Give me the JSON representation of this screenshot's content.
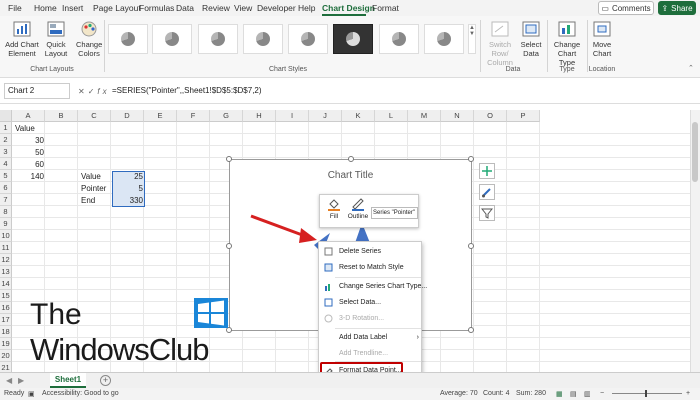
{
  "menu": {
    "tabs": [
      "File",
      "Home",
      "Insert",
      "Page Layout",
      "Formulas",
      "Data",
      "Review",
      "View",
      "Developer",
      "Help",
      "Chart Design",
      "Format"
    ],
    "active": "Chart Design",
    "comments_label": "Comments",
    "share_label": "Share"
  },
  "ribbon": {
    "add_chart_element": "Add Chart Element",
    "quick_layout": "Quick Layout",
    "change_colors": "Change Colors",
    "chart_layouts_label": "Chart Layouts",
    "chart_styles_label": "Chart Styles",
    "switch_row_column": "Switch Row/ Column",
    "select_data": "Select Data",
    "data_label": "Data",
    "change_chart_type": "Change Chart Type",
    "type_label": "Type",
    "move_chart": "Move Chart",
    "location_label": "Location"
  },
  "formula_bar": {
    "name_box": "Chart 2",
    "formula": "=SERIES(\"Pointer\",,Sheet1!$D$5:$D$7,2)"
  },
  "columns": [
    "A",
    "B",
    "C",
    "D",
    "E",
    "F",
    "G",
    "H",
    "I",
    "J",
    "K",
    "L",
    "M",
    "N",
    "O",
    "P"
  ],
  "rows": [
    "1",
    "2",
    "3",
    "4",
    "5",
    "6",
    "7",
    "8",
    "9",
    "10",
    "11",
    "12",
    "13",
    "14",
    "15",
    "16",
    "17",
    "18",
    "19",
    "20",
    "21"
  ],
  "cells": {
    "a1": "Value",
    "a2": "30",
    "a3": "50",
    "a4": "60",
    "a5": "140",
    "c5": "Value",
    "c6": "Pointer",
    "c7": "End",
    "d5": "25",
    "d6": "5",
    "d7": "330"
  },
  "chart": {
    "title": "Chart Title"
  },
  "mini_toolbar": {
    "fill": "Fill",
    "outline": "Outline",
    "series": "Series \"Pointer\""
  },
  "context_menu": {
    "items": [
      "Delete Series",
      "Reset to Match Style",
      "Change Series Chart Type...",
      "Select Data...",
      "3-D Rotation...",
      "Add Data Label",
      "Add Trendline...",
      "Format Data Point..."
    ]
  },
  "watermark": {
    "line1": "The",
    "line2": "WindowsClub"
  },
  "sheet_tab": "Sheet1",
  "status": {
    "ready": "Ready",
    "accessibility": "Accessibility: Good to go",
    "average": "Average: 70",
    "count": "Count: 4",
    "sum": "Sum: 280"
  },
  "colors": {
    "excel_green": "#1e6e3c",
    "highlight_red": "#c00000",
    "selection_blue": "#2f6bbf"
  }
}
